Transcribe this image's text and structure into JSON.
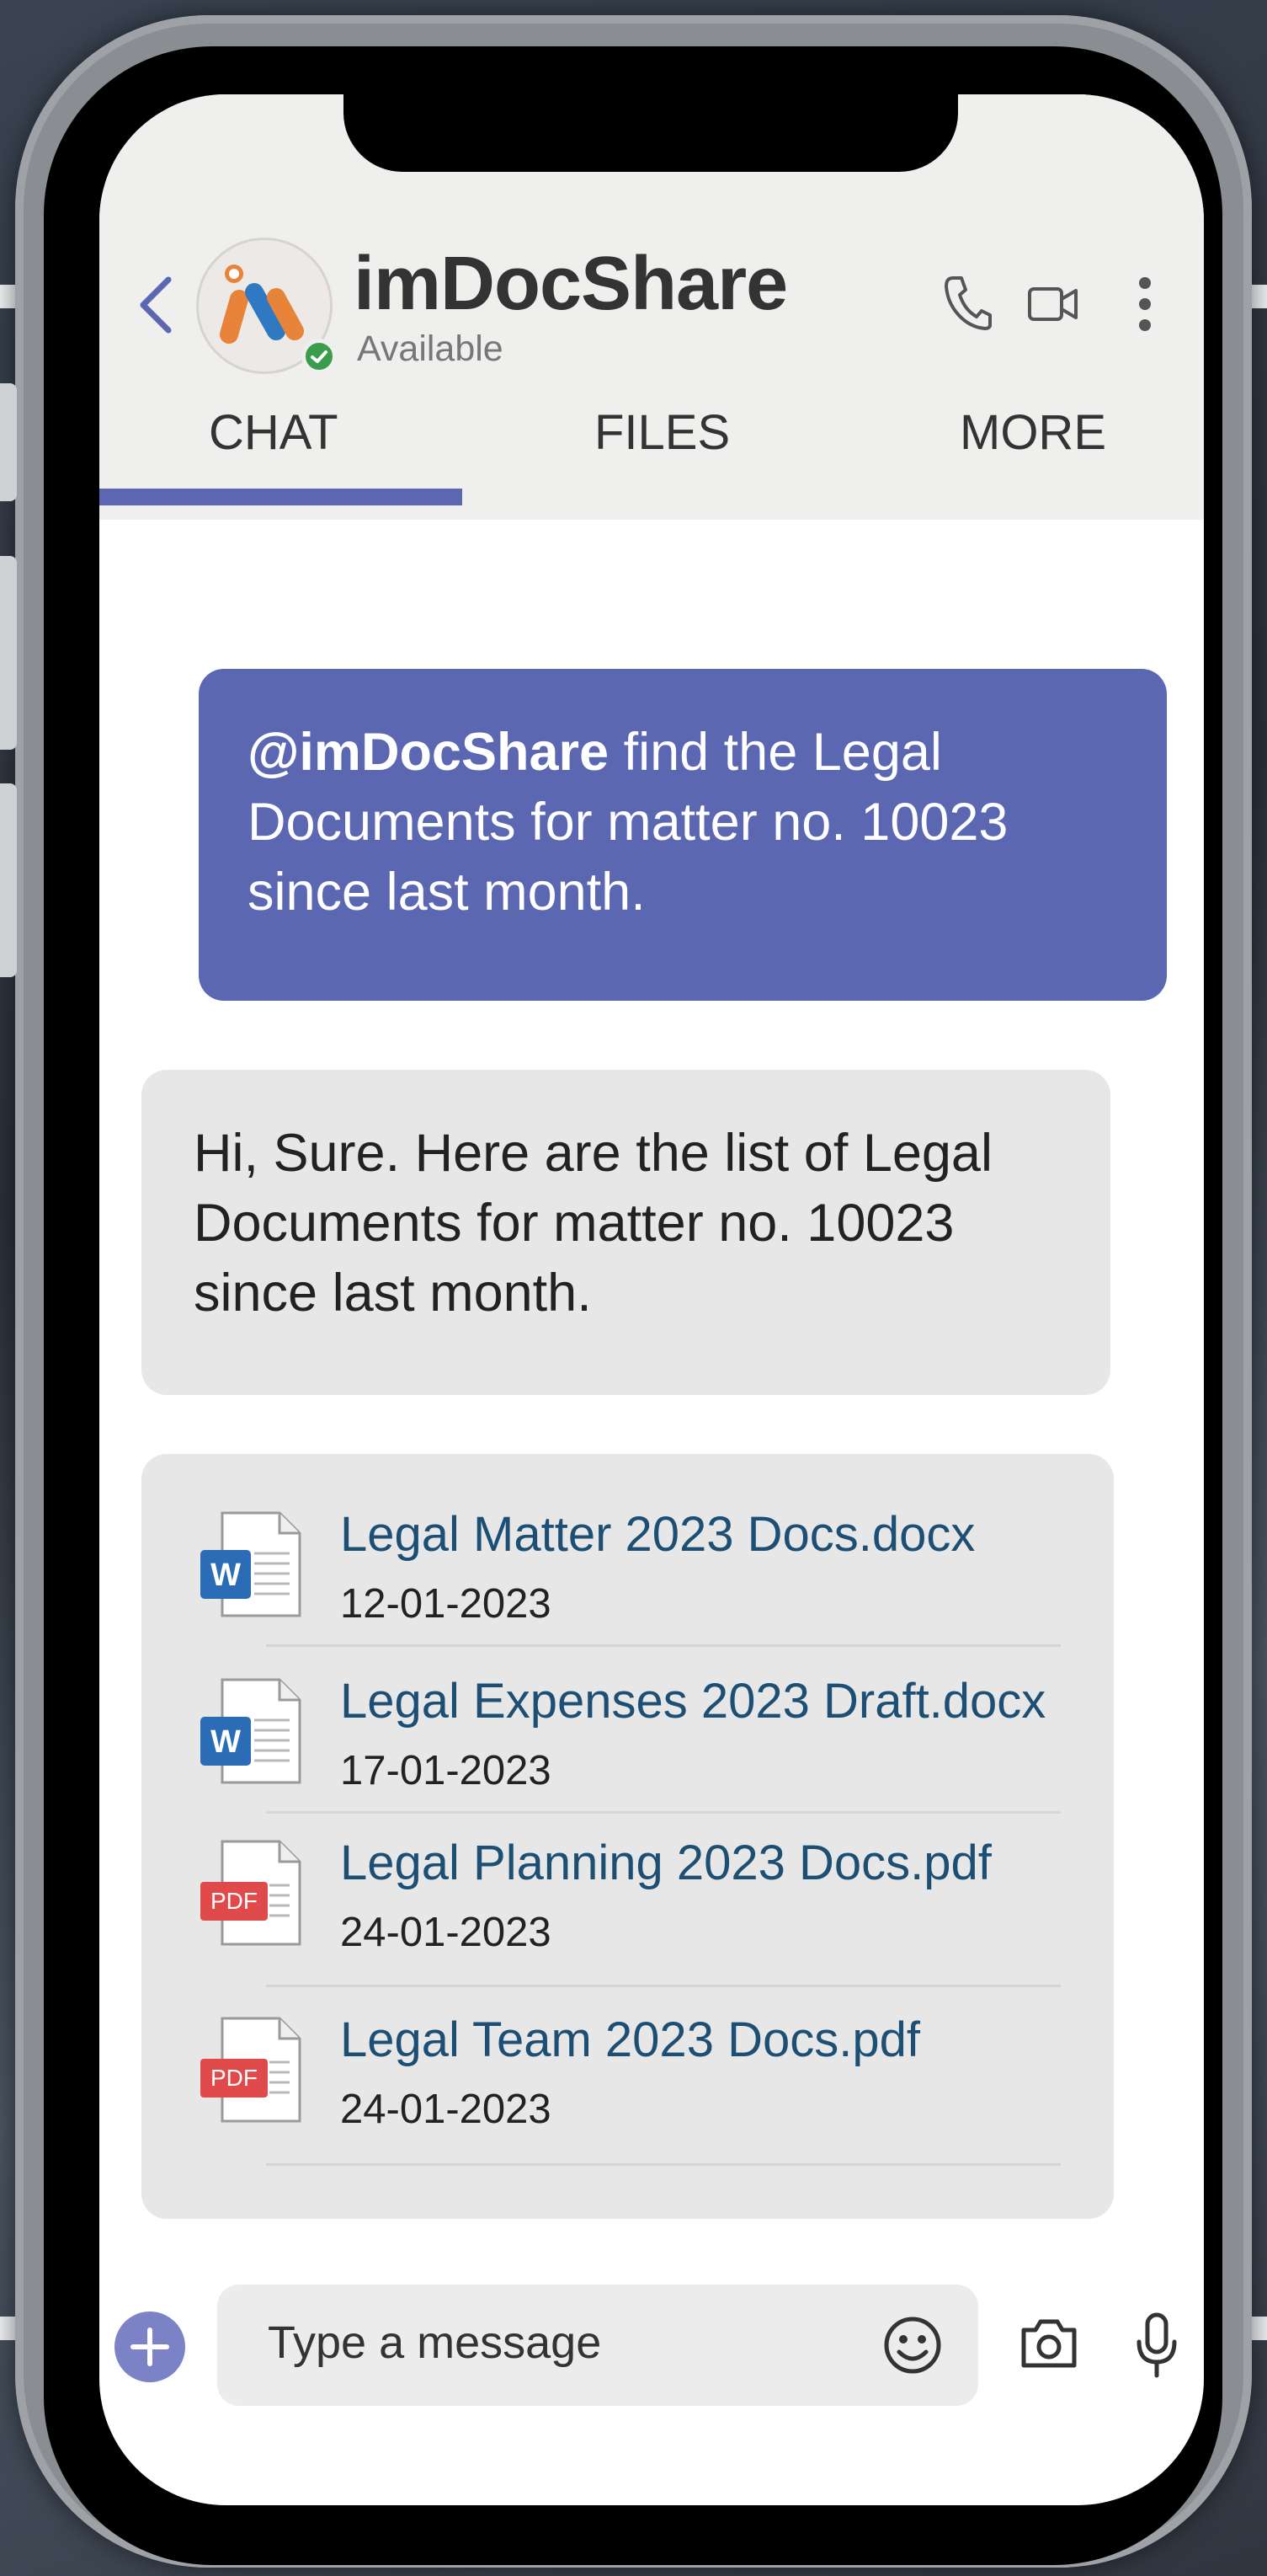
{
  "header": {
    "app_name": "imDocShare",
    "status": "Available",
    "icons": [
      "back-arrow-icon",
      "phone-icon",
      "video-icon",
      "more-vertical-icon"
    ]
  },
  "tabs": [
    {
      "label": "CHAT",
      "active": true
    },
    {
      "label": "FILES",
      "active": false
    },
    {
      "label": "MORE",
      "active": false
    }
  ],
  "colors": {
    "accent": "#5b67b1",
    "file_link": "#1d4f74",
    "presence": "#3b9c4b",
    "pdf_badge": "#e04a4a",
    "word_badge": "#2b6cb7"
  },
  "messages": {
    "sent": {
      "mention": "@imDocShare",
      "text": " find the Legal Documents for matter no. 10023 since last month."
    },
    "received": {
      "text": "Hi, Sure. Here are the list of Legal Documents for matter no. 10023 since last month."
    }
  },
  "files": [
    {
      "name": "Legal Matter 2023 Docs.docx",
      "date": "12-01-2023",
      "type": "word",
      "badge": "W"
    },
    {
      "name": "Legal Expenses 2023 Draft.docx",
      "date": "17-01-2023",
      "type": "word",
      "badge": "W"
    },
    {
      "name": "Legal Planning 2023 Docs.pdf",
      "date": "24-01-2023",
      "type": "pdf",
      "badge": "PDF"
    },
    {
      "name": "Legal Team 2023 Docs.pdf",
      "date": "24-01-2023",
      "type": "pdf",
      "badge": "PDF"
    }
  ],
  "composer": {
    "placeholder": "Type a message",
    "icons": [
      "add-icon",
      "emoji-icon",
      "camera-icon",
      "microphone-icon"
    ]
  }
}
